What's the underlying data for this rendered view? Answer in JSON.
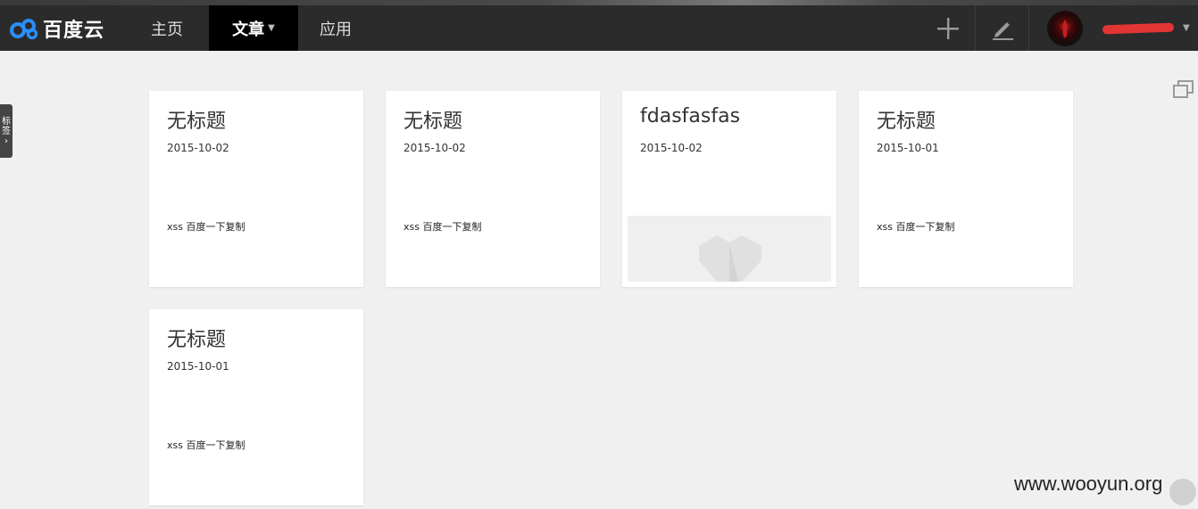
{
  "brand": {
    "name": "百度云"
  },
  "nav": {
    "home": "主页",
    "articles": "文章",
    "apps": "应用"
  },
  "icons": {
    "logo": "baidu-cloud-logo-icon",
    "add": "plus-icon",
    "write": "pencil-icon",
    "restore": "window-restore-icon"
  },
  "side_tab": {
    "label_1": "标",
    "label_2": "签",
    "arrow": "›"
  },
  "cards": [
    {
      "title": "无标题",
      "date": "2015-10-02",
      "excerpt": "xss 百度一下复制"
    },
    {
      "title": "无标题",
      "date": "2015-10-02",
      "excerpt": "xss 百度一下复制"
    },
    {
      "title": "fdasfasfas",
      "date": "2015-10-02",
      "excerpt": ""
    },
    {
      "title": "无标题",
      "date": "2015-10-01",
      "excerpt": "xss 百度一下复制"
    },
    {
      "title": "无标题",
      "date": "2015-10-01",
      "excerpt": "xss 百度一下复制"
    }
  ],
  "watermark": "www.wooyun.org",
  "colors": {
    "navbar": "#2b2b2b",
    "active_tab": "#000000",
    "background": "#f0f0f0",
    "logo_blue": "#2a8ff7",
    "redaction": "#e43535"
  }
}
